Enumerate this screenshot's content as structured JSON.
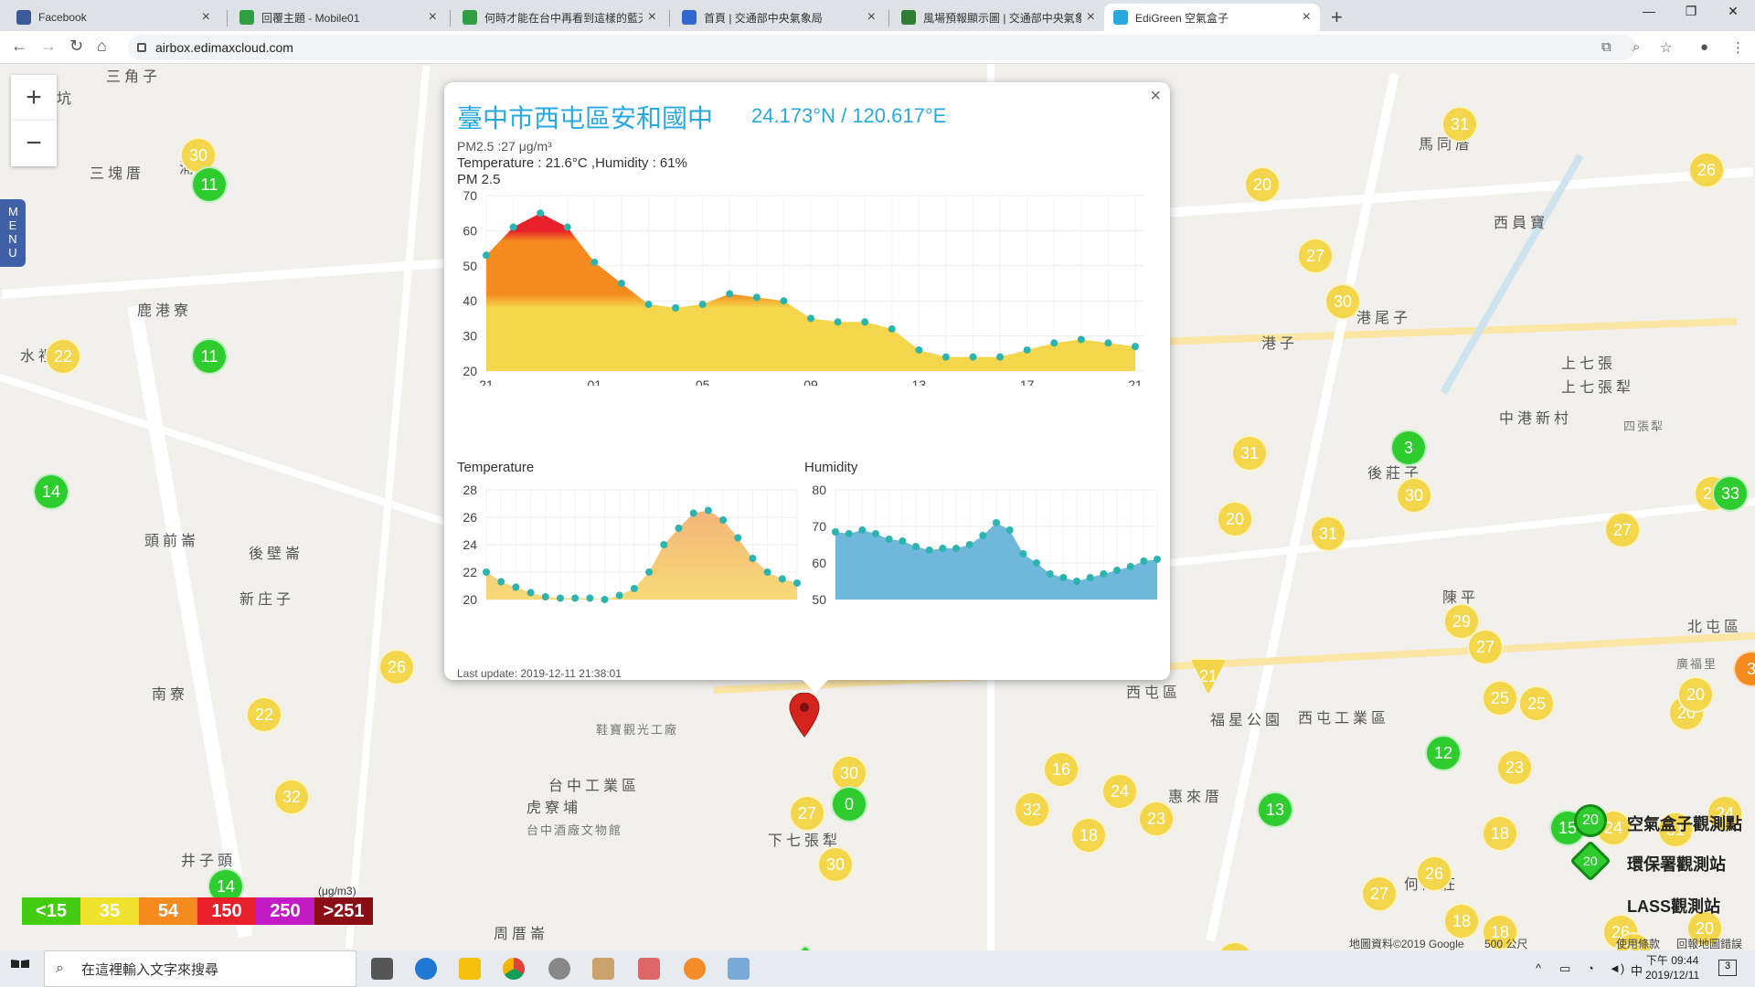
{
  "browser": {
    "tabs": [
      {
        "label": "Facebook",
        "color": "#3b5998"
      },
      {
        "label": "回覆主題 - Mobile01",
        "color": "#2e9e42"
      },
      {
        "label": "何時才能在台中再看到這樣的藍天",
        "color": "#2e9e42"
      },
      {
        "label": "首頁 | 交通部中央氣象局",
        "color": "#3366cc"
      },
      {
        "label": "風場預報顯示圖 | 交通部中央氣象局",
        "color": "#2e7d32"
      },
      {
        "label": "EdiGreen 空氣盒子",
        "color": "#29a8e0"
      }
    ],
    "url": "airbox.edimaxcloud.com"
  },
  "map": {
    "menu_label": "MENU",
    "zoom_in": "+",
    "zoom_out": "−",
    "places": [
      "三角子",
      "坑",
      "三塊厝",
      "浦子",
      "鹿港寮",
      "水裡社",
      "頭前崙",
      "後壁崙",
      "新庄子",
      "南寮",
      "井子頭",
      "周厝崙",
      "台中工業區",
      "虎寮埔",
      "台中酒廠文物館",
      "鞋寶觀光工廠",
      "下七張犁",
      "西屯區",
      "福星公園",
      "西屯工業區",
      "惠來厝",
      "何厝莊",
      "港子",
      "港尾子",
      "馬同厝",
      "西員寶",
      "上七張",
      "上七張犁",
      "中港新村",
      "後莊子",
      "陳平",
      "北屯區",
      "廣福里",
      "四張犁"
    ],
    "markers": [
      "30",
      "11",
      "22",
      "11",
      "14",
      "26",
      "22",
      "32",
      "14",
      "15",
      "30",
      "0",
      "27",
      "30",
      "16",
      "24",
      "23",
      "18",
      "21",
      "31",
      "20",
      "30",
      "3",
      "30",
      "31",
      "20",
      "27",
      "29",
      "27",
      "25",
      "25",
      "12",
      "23",
      "13",
      "15",
      "18",
      "26",
      "27",
      "18",
      "32",
      "21",
      "31",
      "24",
      "26",
      "24",
      "31",
      "31",
      "20",
      "23",
      "27",
      "33",
      "26",
      "3",
      "20",
      "32",
      "28",
      "34",
      "32",
      "20",
      "21",
      "24",
      "31",
      "24",
      "18"
    ]
  },
  "popup": {
    "title": "臺中市西屯區安和國中",
    "coordinates": "24.173°N / 120.617°E",
    "pm_line": "PM2.5 :27 μg/m³",
    "weather_line": "Temperature : 21.6°C ,Humidity : 61%",
    "main_chart_label": "PM 2.5",
    "temp_chart_label": "Temperature",
    "hum_chart_label": "Humidity",
    "last_update": "Last update: 2019-12-11 21:38:01",
    "close": "×"
  },
  "chart_data": [
    {
      "type": "area",
      "title": "PM 2.5",
      "x": [
        "21",
        "22",
        "23",
        "00",
        "01",
        "02",
        "03",
        "04",
        "05",
        "06",
        "07",
        "08",
        "09",
        "10",
        "11",
        "12",
        "13",
        "14",
        "15",
        "16",
        "17",
        "18",
        "19",
        "20",
        "21"
      ],
      "xticks": [
        "21",
        "01",
        "05",
        "09",
        "13",
        "17",
        "21"
      ],
      "values": [
        53,
        61,
        65,
        61,
        51,
        45,
        39,
        38,
        39,
        42,
        41,
        40,
        35,
        34,
        34,
        32,
        26,
        24,
        24,
        24,
        26,
        28,
        29,
        28,
        27
      ],
      "ylim": [
        20,
        70
      ],
      "yticks": [
        20,
        30,
        40,
        50,
        60,
        70
      ],
      "colors": [
        "#f3d64b",
        "#f58a1f",
        "#e8202a"
      ]
    },
    {
      "type": "area",
      "title": "Temperature",
      "values": [
        22.0,
        21.3,
        20.9,
        20.5,
        20.2,
        20.1,
        20.1,
        20.1,
        20.0,
        20.3,
        20.8,
        22.0,
        24.0,
        25.2,
        26.3,
        26.5,
        25.8,
        24.5,
        23.0,
        22.0,
        21.5,
        21.2
      ],
      "ylim": [
        20,
        28
      ],
      "yticks": [
        20,
        22,
        24,
        26,
        28
      ],
      "colors": [
        "#f7cf6f",
        "#f3b57a"
      ]
    },
    {
      "type": "area",
      "title": "Humidity",
      "values": [
        68.5,
        68.0,
        69.0,
        68.0,
        66.5,
        66.0,
        64.5,
        63.5,
        64.0,
        64.0,
        65.0,
        67.5,
        71.0,
        69.0,
        62.5,
        60.0,
        57.0,
        56.0,
        55.0,
        56.0,
        57.0,
        58.0,
        59.0,
        60.5,
        61.0
      ],
      "ylim": [
        50,
        80
      ],
      "yticks": [
        50,
        60,
        70,
        80
      ],
      "colors": [
        "#7cc5e6"
      ]
    }
  ],
  "legend": {
    "items": [
      {
        "label": "<15",
        "color": "#44cc11"
      },
      {
        "label": "35",
        "color": "#f0e12c"
      },
      {
        "label": "54",
        "color": "#f58a1f"
      },
      {
        "label": "150",
        "color": "#e8202a"
      },
      {
        "label": "250",
        "color": "#c21cc6"
      },
      {
        "label": ">251",
        "color": "#8b0d16"
      }
    ],
    "unit": "(μg/m3)",
    "map_legend": [
      "空氣盒子觀測點",
      "環保署觀測站",
      "LASS觀測站"
    ],
    "map_legend_value": "20"
  },
  "footer": {
    "copyright": "地圖資料©2019 Google",
    "scale": "500 公尺",
    "terms": "使用條款",
    "report": "回報地圖錯誤"
  },
  "taskbar": {
    "search_placeholder": "在這裡輸入文字來搜尋",
    "time": "下午 09:44",
    "date": "2019/12/11",
    "notification_count": "3"
  }
}
